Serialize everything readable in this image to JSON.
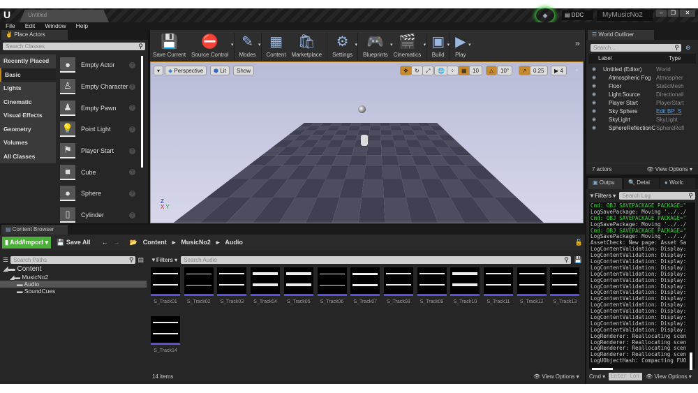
{
  "window": {
    "doc_tab": "Untitled",
    "project": "MyMusicNo2",
    "ddc": "DDC",
    "controls": [
      "–",
      "❐",
      "✕"
    ]
  },
  "menu": [
    "File",
    "Edit",
    "Window",
    "Help"
  ],
  "place_actors": {
    "tab": "Place Actors",
    "search_placeholder": "Search Classes",
    "categories": [
      "Recently Placed",
      "Basic",
      "Lights",
      "Cinematic",
      "Visual Effects",
      "Geometry",
      "Volumes",
      "All Classes"
    ],
    "selected": "Basic",
    "actors": [
      {
        "label": "Empty Actor",
        "icon": "sphere-icon"
      },
      {
        "label": "Empty Character",
        "icon": "character-icon"
      },
      {
        "label": "Empty Pawn",
        "icon": "pawn-icon"
      },
      {
        "label": "Point Light",
        "icon": "bulb-icon"
      },
      {
        "label": "Player Start",
        "icon": "flag-icon"
      },
      {
        "label": "Cube",
        "icon": "cube-icon"
      },
      {
        "label": "Sphere",
        "icon": "sphere-icon"
      },
      {
        "label": "Cylinder",
        "icon": "cylinder-icon"
      }
    ]
  },
  "toolbar": [
    {
      "label": "Save Current",
      "icon": "💾"
    },
    {
      "label": "Source Control",
      "icon": "⛔"
    },
    {
      "label": "Modes",
      "icon": "✎"
    },
    {
      "label": "Content",
      "icon": "▦"
    },
    {
      "label": "Marketplace",
      "icon": "🛍"
    },
    {
      "label": "Settings",
      "icon": "⚙"
    },
    {
      "label": "Blueprints",
      "icon": "🎮"
    },
    {
      "label": "Cinematics",
      "icon": "🎬"
    },
    {
      "label": "Build",
      "icon": "▣"
    },
    {
      "label": "Play",
      "icon": "▶"
    }
  ],
  "viewport": {
    "view": "Perspective",
    "lit": "Lit",
    "show": "Show",
    "grid": "10",
    "rotation": "10°",
    "scale": "0.25",
    "camera_speed": "4",
    "accent": "#c88a2c"
  },
  "outliner": {
    "tab": "World Outliner",
    "search_placeholder": "Search...",
    "col_label": "Label",
    "col_type": "Type",
    "rows": [
      {
        "label": "Untitled (Editor)",
        "type": "World"
      },
      {
        "label": "Atmospheric Fog",
        "type": "Atmospher"
      },
      {
        "label": "Floor",
        "type": "StaticMesh"
      },
      {
        "label": "Light Source",
        "type": "Directionall"
      },
      {
        "label": "Player Start",
        "type": "PlayerStart"
      },
      {
        "label": "Sky Sphere",
        "type": "Edit BP_S"
      },
      {
        "label": "SkyLight",
        "type": "SkyLight"
      },
      {
        "label": "SphereReflectionC",
        "type": "SphereRefl"
      }
    ],
    "count": "7 actors",
    "view_options": "View Options"
  },
  "log": {
    "tabs": [
      "Outpu",
      "Detai",
      "Worlc"
    ],
    "filters": "Filters",
    "search_placeholder": "Search Log",
    "lines": [
      {
        "t": "Cmd: OBJ SAVEPACKAGE PACKAGE=\"",
        "cmd": true
      },
      {
        "t": "LogSavePackage: Moving '../../"
      },
      {
        "t": "Cmd: OBJ SAVEPACKAGE PACKAGE=\"",
        "cmd": true
      },
      {
        "t": "LogSavePackage: Moving '../../"
      },
      {
        "t": "Cmd: OBJ SAVEPACKAGE PACKAGE=\"",
        "cmd": true
      },
      {
        "t": "LogSavePackage: Moving '../../"
      },
      {
        "t": "AssetCheck: New page: Asset Sa"
      },
      {
        "t": "LogContentValidation: Display:"
      },
      {
        "t": "LogContentValidation: Display:"
      },
      {
        "t": "LogContentValidation: Display:"
      },
      {
        "t": "LogContentValidation: Display:"
      },
      {
        "t": "LogContentValidation: Display:"
      },
      {
        "t": "LogContentValidation: Display:"
      },
      {
        "t": "LogContentValidation: Display:"
      },
      {
        "t": "LogContentValidation: Display:"
      },
      {
        "t": "LogContentValidation: Display:"
      },
      {
        "t": "LogContentValidation: Display:"
      },
      {
        "t": "LogContentValidation: Display:"
      },
      {
        "t": "LogContentValidation: Display:"
      },
      {
        "t": "LogContentValidation: Display:"
      },
      {
        "t": "LogContentValidation: Display:"
      },
      {
        "t": "LogRenderer: Reallocating scen"
      },
      {
        "t": "LogRenderer: Reallocating scen"
      },
      {
        "t": "LogRenderer: Reallocating scen"
      },
      {
        "t": "LogRenderer: Reallocating scen"
      },
      {
        "t": "LogUObjectHash: Compacting FUO"
      }
    ],
    "cmd": "Cmd",
    "cmd_placeholder": "Enter Con",
    "view_options": "View Options"
  },
  "content_browser": {
    "tab": "Content Browser",
    "add_import": "Add/Import",
    "save_all": "Save All",
    "breadcrumb": [
      "Content",
      "MusicNo2",
      "Audio"
    ],
    "paths_placeholder": "Search Paths",
    "tree": [
      {
        "label": "Content",
        "level": 0
      },
      {
        "label": "MusicNo2",
        "level": 1
      },
      {
        "label": "Audio",
        "level": 2,
        "selected": true
      },
      {
        "label": "SoundCues",
        "level": 2
      }
    ],
    "filters": "Filters",
    "search_placeholder": "Search Audio",
    "assets": [
      "S_Track01",
      "S_Track02",
      "S_Track03",
      "S_Track04",
      "S_Track05",
      "S_Track06",
      "S_Track07",
      "S_Track08",
      "S_Track09",
      "S_Track10",
      "S_Track11",
      "S_Track12",
      "S_Track13",
      "S_Track14"
    ],
    "count": "14 items",
    "view_options": "View Options",
    "accent": "#4caf3a"
  }
}
